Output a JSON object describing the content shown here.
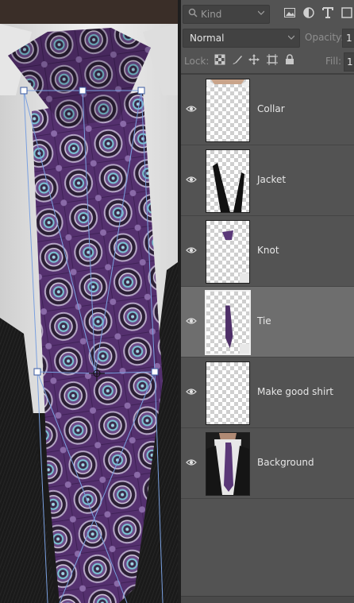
{
  "filter": {
    "kind_label": "Kind",
    "icons": [
      "image-filter-icon",
      "adjustment-filter-icon",
      "type-filter-icon",
      "shape-filter-icon",
      "smart-object-filter-icon"
    ]
  },
  "blend": {
    "mode": "Normal",
    "opacity_label": "Opacity:",
    "opacity_value": "1"
  },
  "lock": {
    "label": "Lock:",
    "icons": [
      "lock-transparent-pixels-icon",
      "lock-image-pixels-icon",
      "lock-position-icon",
      "lock-artboard-icon",
      "lock-all-icon"
    ],
    "fill_label": "Fill:",
    "fill_value": "1"
  },
  "layers": [
    {
      "name": "Collar",
      "visible": true,
      "selected": false,
      "smart_object": false
    },
    {
      "name": "Jacket",
      "visible": true,
      "selected": false,
      "smart_object": false
    },
    {
      "name": "Knot",
      "visible": true,
      "selected": false,
      "smart_object": true
    },
    {
      "name": "Tie",
      "visible": true,
      "selected": true,
      "smart_object": true
    },
    {
      "name": "Make good shirt",
      "visible": true,
      "selected": false,
      "smart_object": false
    },
    {
      "name": "Background",
      "visible": true,
      "selected": false,
      "smart_object": false
    }
  ],
  "colors": {
    "panel": "#535353",
    "selected_layer": "#6e6e6e",
    "tie_purple": "#5a2f78",
    "transform_box": "#7aa0e0"
  }
}
